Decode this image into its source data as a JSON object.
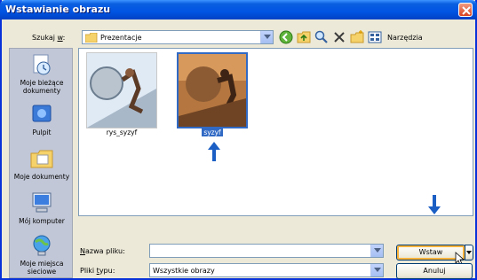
{
  "window": {
    "title": "Wstawianie obrazu"
  },
  "toolbar": {
    "lookin_prefix": "Szukaj ",
    "lookin_hotkey": "w",
    "lookin_suffix": ":",
    "lookin_value": "Prezentacje",
    "tools_label": "Narzędzia",
    "icons": [
      "back-icon",
      "up-folder-icon",
      "search-web-icon",
      "delete-icon",
      "new-folder-icon",
      "views-icon"
    ]
  },
  "places": [
    {
      "label": "Moje bieżące dokumenty",
      "icon": "recent-documents-icon"
    },
    {
      "label": "Pulpit",
      "icon": "desktop-icon"
    },
    {
      "label": "Moje dokumenty",
      "icon": "my-documents-icon"
    },
    {
      "label": "Mój komputer",
      "icon": "my-computer-icon"
    },
    {
      "label": "Moje miejsca sieciowe",
      "icon": "network-places-icon"
    }
  ],
  "files": [
    {
      "name": "rys_syzyf",
      "selected": false
    },
    {
      "name": "syzyf",
      "selected": true
    }
  ],
  "bottom": {
    "filename_label_hotkey": "N",
    "filename_label_rest": "azwa pliku:",
    "filename_value": "",
    "filetype_label_prefix": "Pliki ",
    "filetype_label_hotkey": "t",
    "filetype_label_rest": "ypu:",
    "filetype_value": "Wszystkie obrazy",
    "insert_label": "Wstaw",
    "cancel_label": "Anuluj"
  },
  "colors": {
    "title_bar": "#0054e3",
    "selection": "#316ac5",
    "arrow": "#1b5fc5"
  }
}
